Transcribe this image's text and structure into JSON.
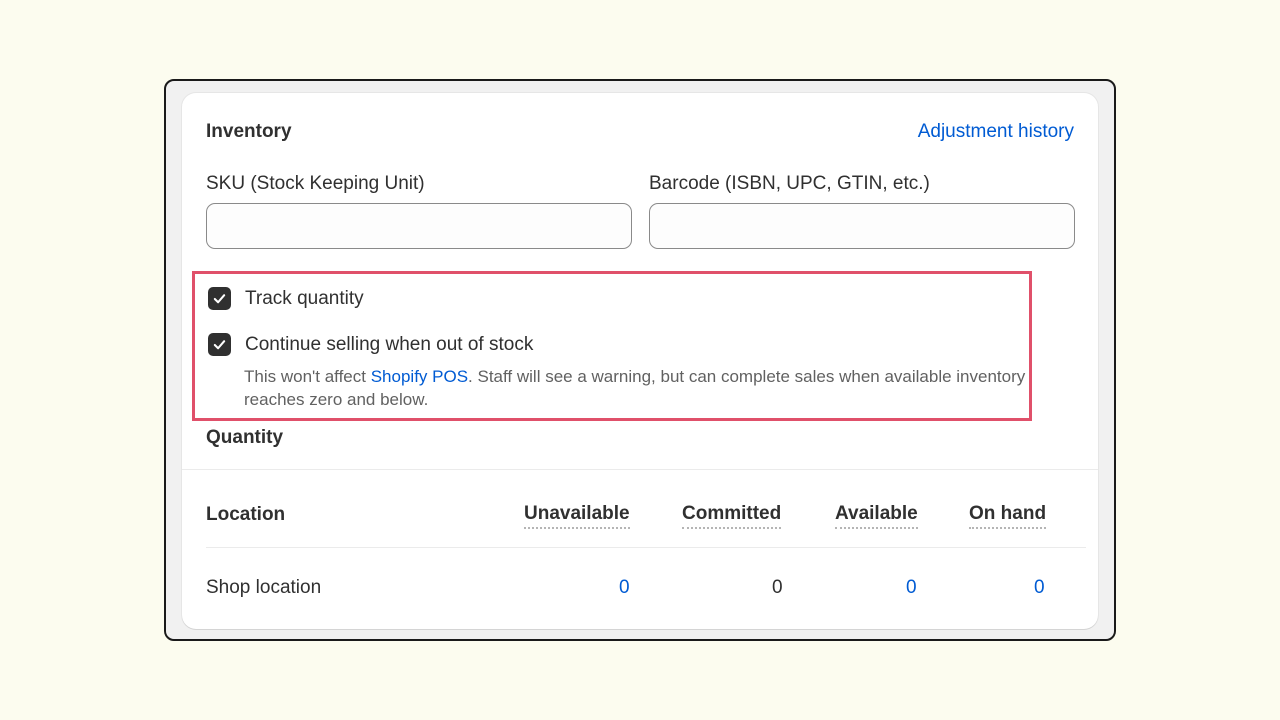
{
  "inventory": {
    "title": "Inventory",
    "adjustment_history_link": "Adjustment history",
    "sku": {
      "label": "SKU (Stock Keeping Unit)",
      "value": "",
      "placeholder": ""
    },
    "barcode": {
      "label": "Barcode (ISBN, UPC, GTIN, etc.)",
      "value": "",
      "placeholder": ""
    },
    "track_quantity": {
      "label": "Track quantity",
      "checked": true
    },
    "continue_selling": {
      "label": "Continue selling when out of stock",
      "checked": true,
      "helper_prefix": "This won't affect ",
      "helper_link": "Shopify POS",
      "helper_suffix": ". Staff will see a warning, but can complete sales when available inventory reaches zero and below."
    },
    "highlight_color": "#e0506a"
  },
  "quantity": {
    "title": "Quantity",
    "columns": {
      "location": "Location",
      "unavailable": "Unavailable",
      "committed": "Committed",
      "available": "Available",
      "on_hand": "On hand"
    },
    "rows": [
      {
        "location": "Shop location",
        "unavailable": "0",
        "committed": "0",
        "available": "0",
        "on_hand": "0"
      }
    ]
  },
  "colors": {
    "link": "#005bd3",
    "page_background": "#fcfcef",
    "checkbox_fill": "#303030"
  },
  "icons": {
    "checkbox": "checkmark-icon"
  }
}
